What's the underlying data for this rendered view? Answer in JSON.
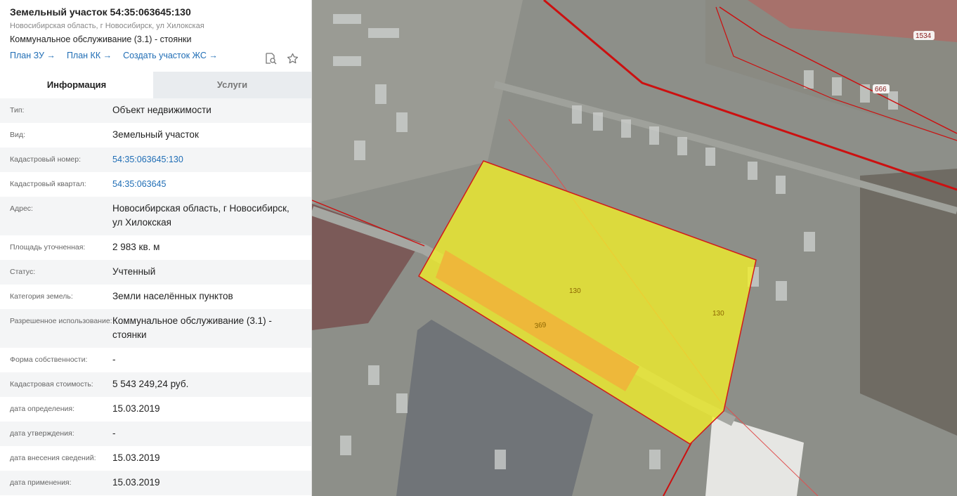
{
  "card": {
    "title": "Земельный участок 54:35:063645:130",
    "address_short": "Новосибирская область, г Новосибирск, ул Хилокская",
    "use_kind": "Коммунальное обслуживание (3.1) - стоянки",
    "links": [
      "План ЗУ →",
      "План КК →",
      "Создать участок ЖС →"
    ],
    "icons": [
      "search-document-icon",
      "star-icon"
    ]
  },
  "tabs": [
    "Информация",
    "Услуги"
  ],
  "info_rows": [
    {
      "label": "Тип:",
      "value": "Объект недвижимости"
    },
    {
      "label": "Вид:",
      "value": "Земельный участок"
    },
    {
      "label": "Кадастровый номер:",
      "value": "54:35:063645:130",
      "is_link": true
    },
    {
      "label": "Кадастровый квартал:",
      "value": "54:35:063645",
      "is_link": true
    },
    {
      "label": "Адрес:",
      "value": "Новосибирская область, г Новосибирск, ул Хилокская"
    },
    {
      "label": "Площадь уточненная:",
      "value": "2 983 кв. м"
    },
    {
      "label": "Статус:",
      "value": "Учтенный"
    },
    {
      "label": "Категория земель:",
      "value": "Земли населённых пунктов"
    },
    {
      "label": "Разрешенное использование:",
      "value": "Коммунальное обслуживание (3.1) - стоянки"
    },
    {
      "label": "Форма собственности:",
      "value": "-"
    },
    {
      "label": "Кадастровая стоимость:",
      "value": "5 543 249,24 руб."
    },
    {
      "label": "дата определения:",
      "value": "15.03.2019"
    },
    {
      "label": "дата утверждения:",
      "value": "-"
    },
    {
      "label": "дата внесения сведений:",
      "value": "15.03.2019"
    },
    {
      "label": "дата применения:",
      "value": "15.03.2019"
    }
  ],
  "map": {
    "parcel_labels": [
      "130",
      "130",
      "369"
    ],
    "boundary_labels": [
      "1534",
      "666"
    ],
    "colors": {
      "parcel_fill": "#f2ef28",
      "building_fill": "#f0b43a",
      "boundary": "#cc1010"
    }
  }
}
